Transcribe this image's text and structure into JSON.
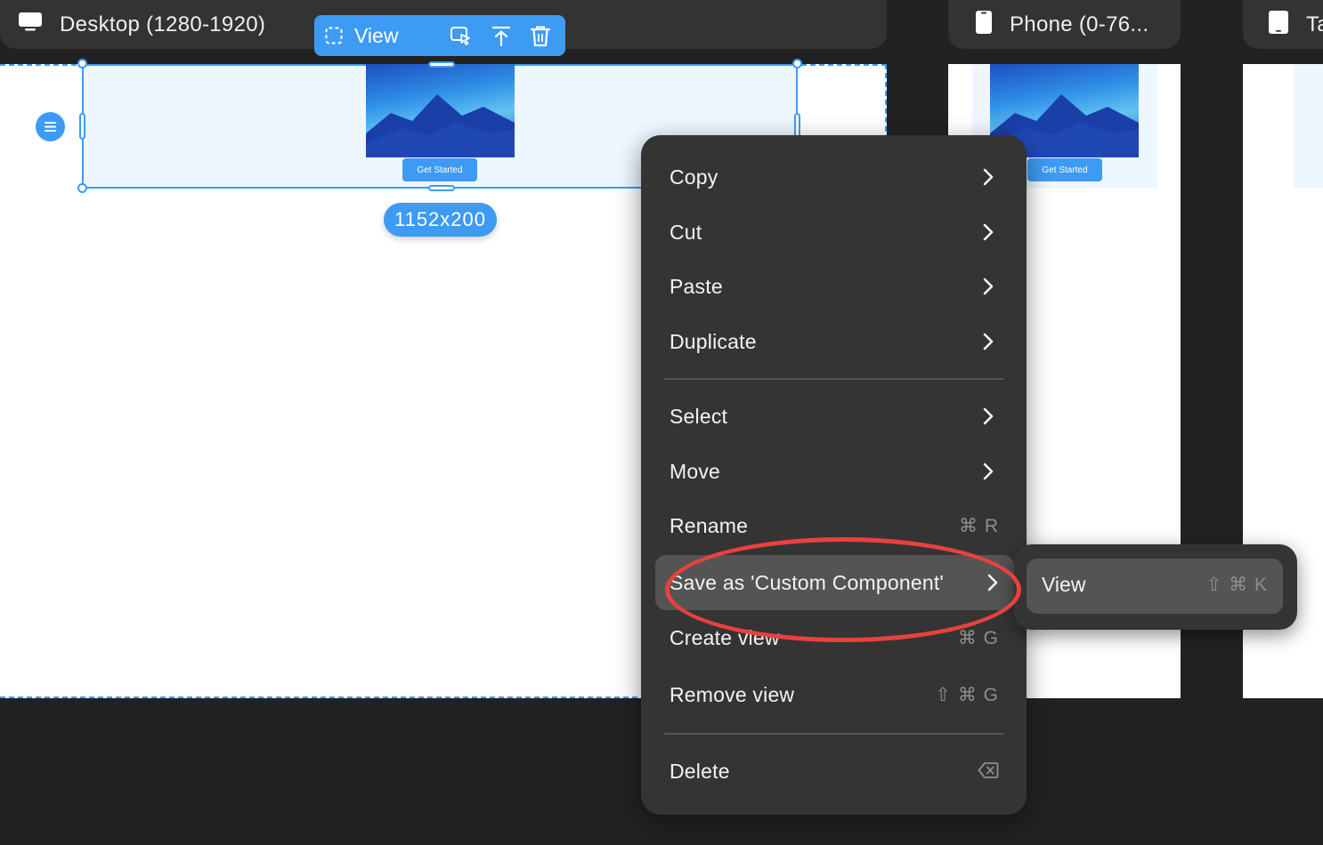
{
  "frames": {
    "desktop": {
      "title": "Desktop (1280-1920)"
    },
    "phone": {
      "title": "Phone (0-76..."
    },
    "tablet": {
      "title": "Ta"
    }
  },
  "toolbar": {
    "label": "View"
  },
  "selection": {
    "dimensions": "1152x200"
  },
  "hero": {
    "cta_label": "Get Started"
  },
  "context_menu": {
    "items": [
      {
        "label": "Copy",
        "shortcut": ""
      },
      {
        "label": "Cut",
        "shortcut": ""
      },
      {
        "label": "Paste",
        "shortcut": ""
      },
      {
        "label": "Duplicate",
        "shortcut": ""
      },
      {
        "label": "Select",
        "shortcut": ""
      },
      {
        "label": "Move",
        "shortcut": ""
      },
      {
        "label": "Rename",
        "shortcut": "⌘ R"
      },
      {
        "label": "Save as 'Custom Component'",
        "shortcut": ""
      },
      {
        "label": "Create view",
        "shortcut": "⌘ G"
      },
      {
        "label": "Remove view",
        "shortcut": "⇧ ⌘ G"
      },
      {
        "label": "Delete",
        "shortcut": "delete-key-icon"
      }
    ]
  },
  "submenu": {
    "items": [
      {
        "label": "View",
        "shortcut": "⇧ ⌘ K"
      }
    ]
  },
  "colors": {
    "accent": "#3d9bf3",
    "menu_bg": "#343434",
    "highlight": "#545454",
    "annotation": "#e8413f",
    "canvas_bg": "#222222"
  }
}
